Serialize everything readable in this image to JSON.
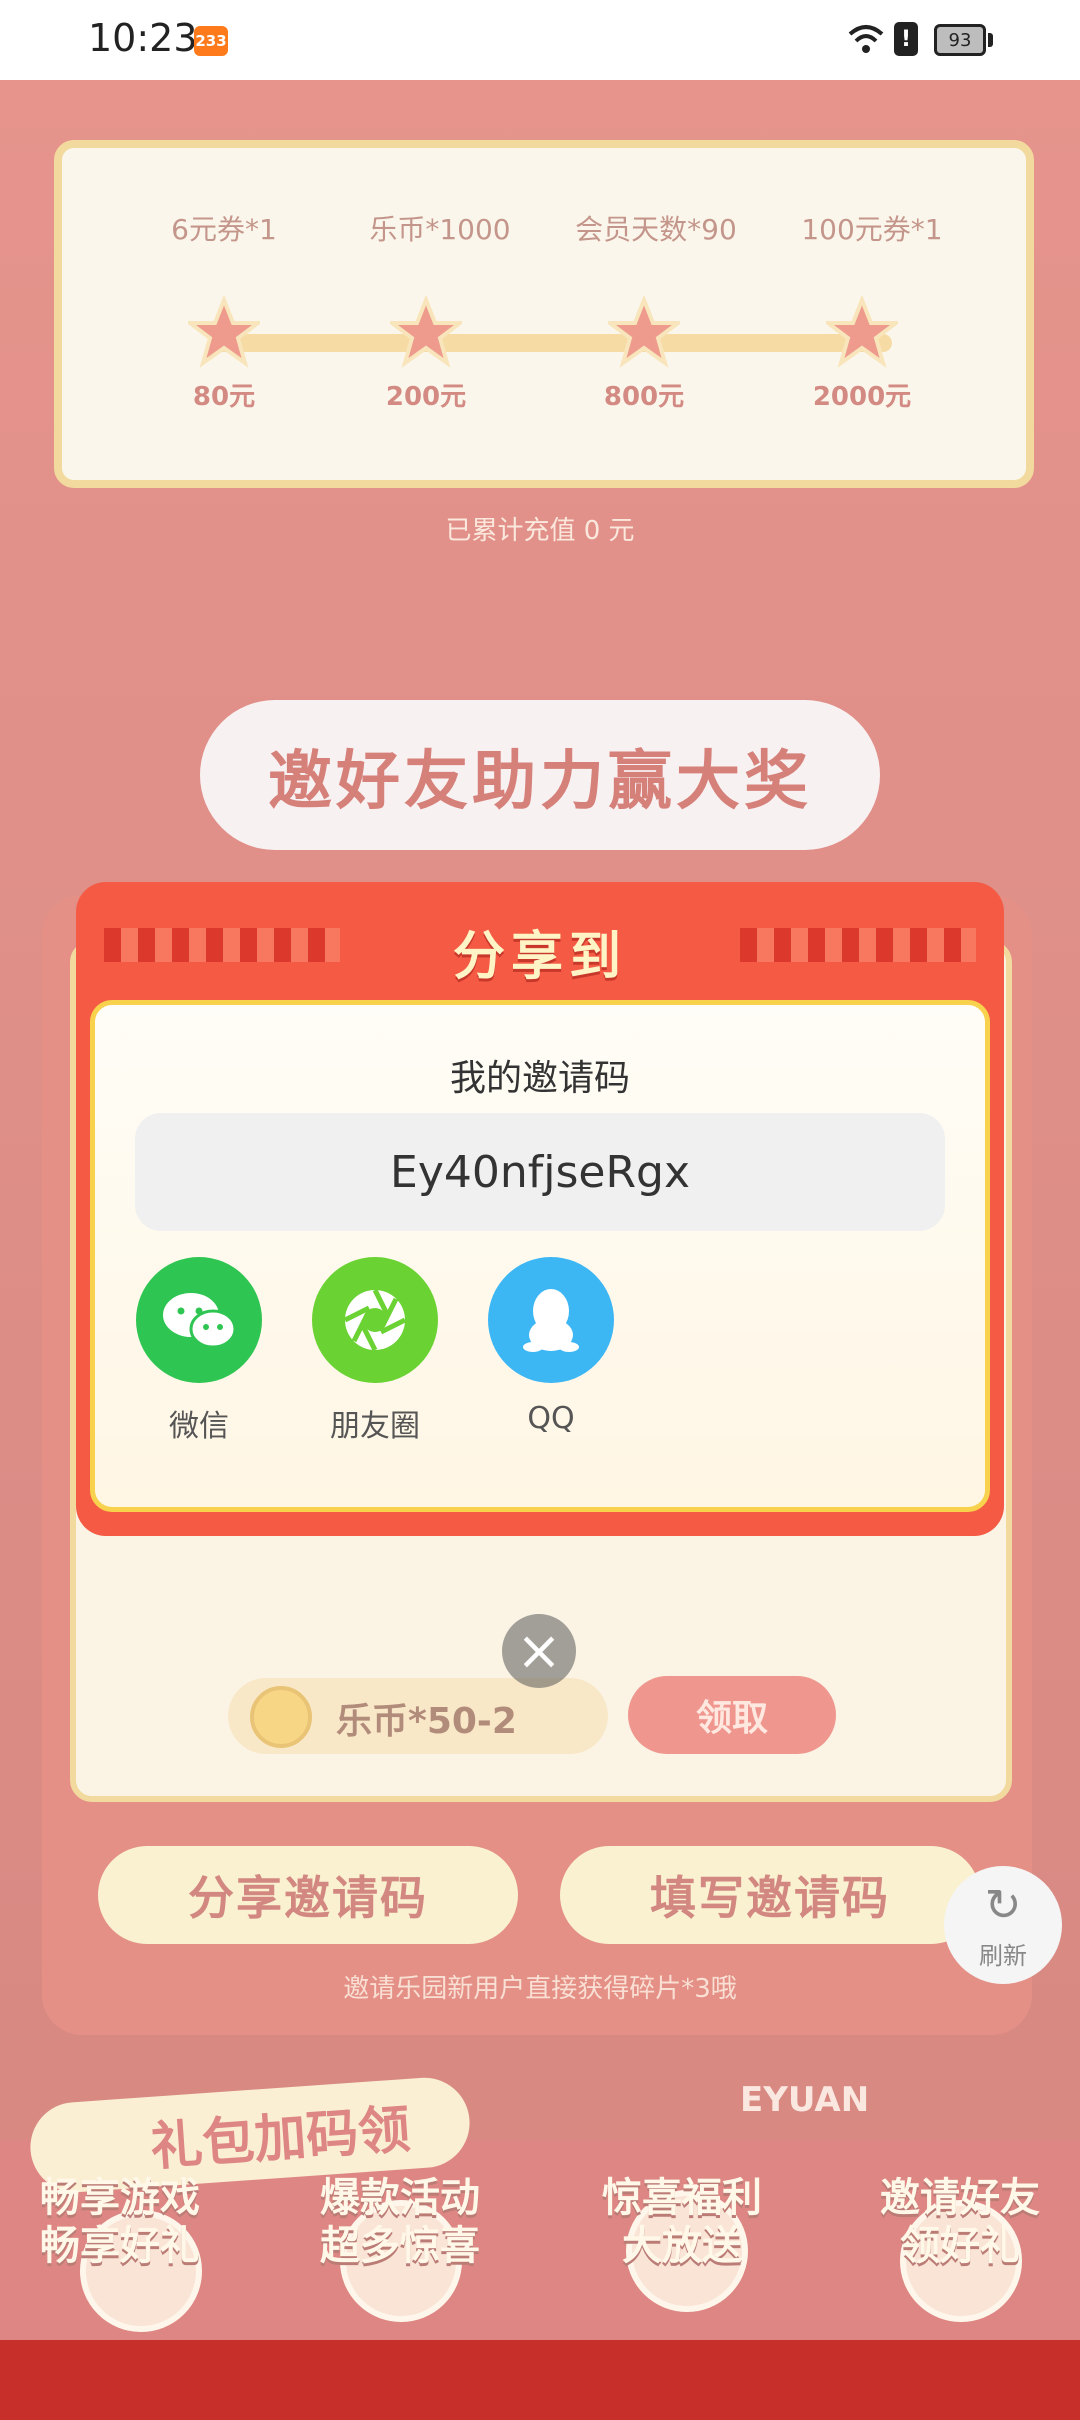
{
  "status_bar": {
    "time": "10:23",
    "notif_badge": "233",
    "battery": "93"
  },
  "top_card": {
    "rewards": [
      "6元券*1",
      "乐币*1000",
      "会员天数*90",
      "100元券*1"
    ],
    "tiers": [
      "80元",
      "200元",
      "800元",
      "2000元"
    ],
    "recharge_text": "已累计充值 0 元"
  },
  "invite_section": {
    "title": "邀好友助力赢大奖",
    "coin_reward": "乐币*50-2",
    "claim_label": "领取",
    "share_code_label": "分享邀请码",
    "fill_code_label": "填写邀请码",
    "tip": "邀请乐园新用户直接获得碎片*3哦"
  },
  "refresh_label": "刷新",
  "bottom": {
    "gift_banner": "礼包加码领",
    "promos": [
      {
        "line1": "畅享游戏",
        "line2": "畅享好礼"
      },
      {
        "line1": "爆款活动",
        "line2": "超多惊喜"
      },
      {
        "line1": "惊喜福利",
        "line2": "大放送"
      },
      {
        "line1": "邀请好友",
        "line2": "领好礼"
      }
    ],
    "brand": "EYUAN"
  },
  "modal": {
    "title": "分享到",
    "code_label": "我的邀请码",
    "code": "Ey40nfjseRgx",
    "share_targets": [
      {
        "label": "微信",
        "icon": "wechat-icon",
        "color": "#2fc552"
      },
      {
        "label": "朋友圈",
        "icon": "moments-icon",
        "color": "#6bd234"
      },
      {
        "label": "QQ",
        "icon": "qq-icon",
        "color": "#3db6f4"
      }
    ],
    "close_icon": "close-icon"
  }
}
